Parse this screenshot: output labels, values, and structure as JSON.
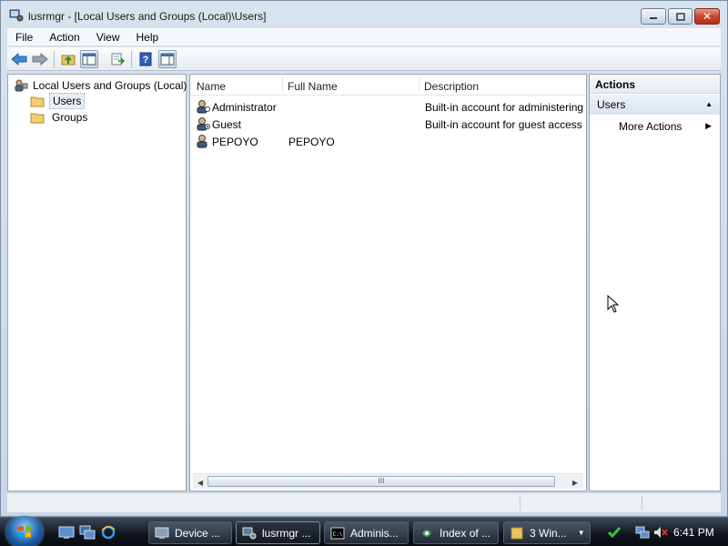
{
  "window": {
    "title": "lusrmgr - [Local Users and Groups (Local)\\Users]",
    "close_glyph": "✕"
  },
  "menu": {
    "items": [
      "File",
      "Action",
      "View",
      "Help"
    ]
  },
  "tree": {
    "root": "Local Users and Groups (Local)",
    "children": [
      "Users",
      "Groups"
    ],
    "selected": "Users"
  },
  "list": {
    "columns": [
      "Name",
      "Full Name",
      "Description"
    ],
    "rows": [
      {
        "name": "Administrator",
        "full_name": "",
        "description": "Built-in account for administering"
      },
      {
        "name": "Guest",
        "full_name": "",
        "description": "Built-in account for guest access t"
      },
      {
        "name": "PEPOYO",
        "full_name": "PEPOYO",
        "description": ""
      }
    ],
    "scroll_grip": "III"
  },
  "actions": {
    "header": "Actions",
    "section": "Users",
    "items": [
      "More Actions"
    ]
  },
  "taskbar": {
    "buttons": [
      "Device ...",
      "lusrmgr ...",
      "Adminis...",
      "Index of ...",
      "3 Win..."
    ],
    "active_button": "lusrmgr ...",
    "clock": "6:41 PM",
    "cmd_icon_text": "C:\\"
  },
  "colors": {
    "accent": "#1b5fa8",
    "close_red": "#c8452c",
    "taskbar": "#0f141c"
  }
}
